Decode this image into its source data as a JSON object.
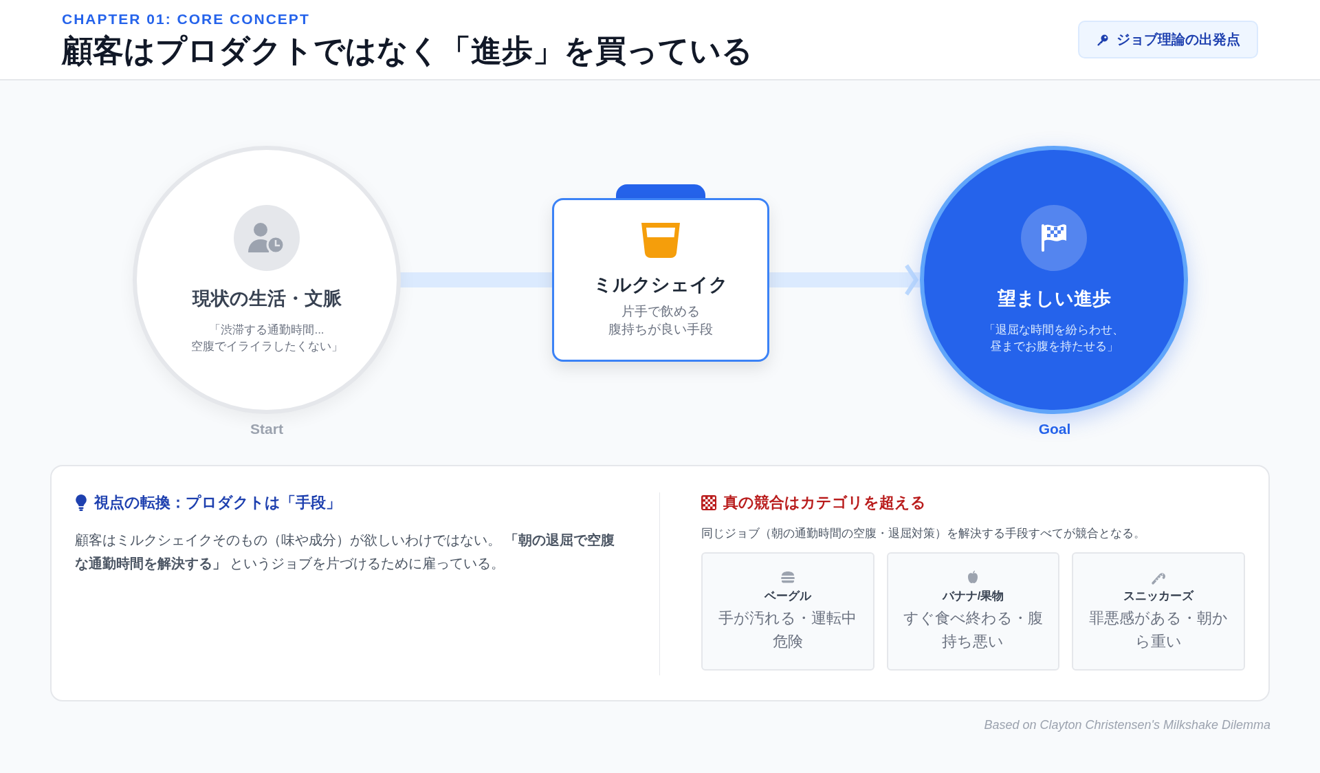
{
  "header": {
    "chapter": "CHAPTER 01: CORE CONCEPT",
    "title": "顧客はプロダクトではなく「進歩」を買っている",
    "badge": "ジョブ理論の出発点"
  },
  "flow": {
    "start": {
      "title": "現状の生活・文脈",
      "quote": [
        "「渋滞する通勤時間...",
        "空腹でイライラしたくない」"
      ],
      "label": "Start"
    },
    "product": {
      "title": "ミルクシェイク",
      "description": [
        "片手で飲める",
        "腹持ちが良い手段"
      ]
    },
    "goal": {
      "title": "望ましい進歩",
      "quote": [
        "「退屈な時間を紛らわせ、",
        "昼までお腹を持たせる」"
      ],
      "label": "Goal"
    }
  },
  "insight": {
    "title": "視点の転換：プロダクトは「手段」",
    "text": "顧客はミルクシェイクそのもの（味や成分）が欲しいわけではない。 **「朝の退屈で空腹な通勤時間を解決する」** というジョブを片づけるために雇っている。"
  },
  "competition": {
    "title": "真の競合はカテゴリを超える",
    "subtitle": "同じジョブ（朝の通勤時間の空腹・退屈対策）を解決する手段すべてが競合となる。",
    "alternatives": [
      {
        "name": "ベーグル",
        "drawback": "手が汚れる・運転中危険"
      },
      {
        "name": "バナナ/果物",
        "drawback": "すぐ食べ終わる・腹持ち悪い"
      },
      {
        "name": "スニッカーズ",
        "drawback": "罪悪感がある・朝から重い"
      }
    ]
  },
  "footer": "Based on Clayton Christensen's Milkshake Dilemma"
}
